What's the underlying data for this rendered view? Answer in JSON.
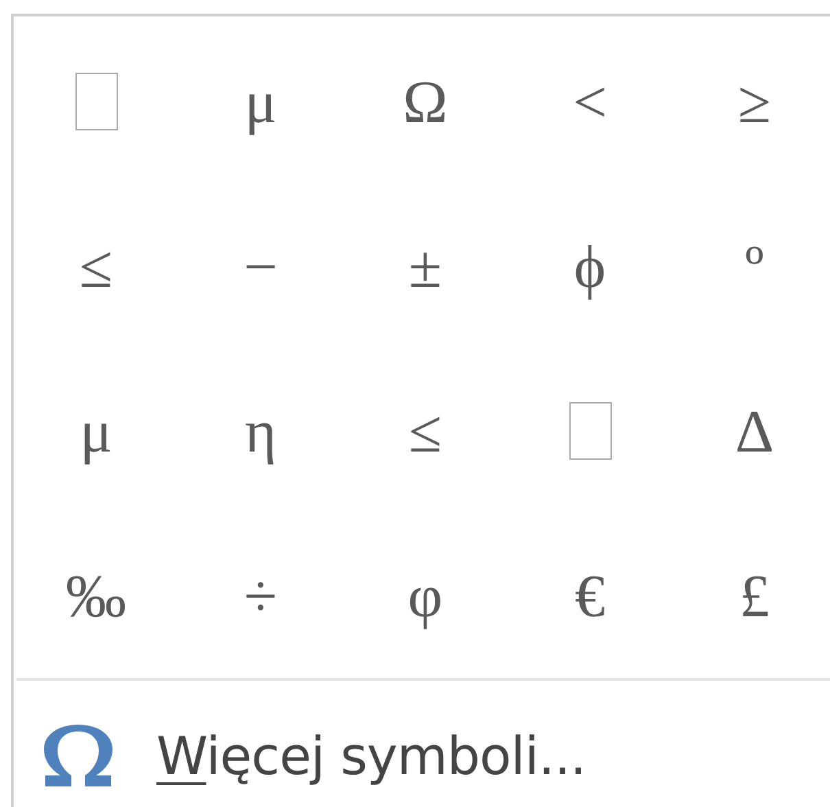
{
  "symbols": [
    {
      "kind": "missing"
    },
    {
      "kind": "glyph",
      "char": "μ"
    },
    {
      "kind": "glyph",
      "char": "Ω"
    },
    {
      "kind": "glyph",
      "char": "<"
    },
    {
      "kind": "glyph",
      "char": "≥"
    },
    {
      "kind": "glyph",
      "char": "≤"
    },
    {
      "kind": "glyph",
      "char": "−"
    },
    {
      "kind": "glyph",
      "char": "±"
    },
    {
      "kind": "glyph",
      "char": "ϕ"
    },
    {
      "kind": "glyph",
      "char": "º"
    },
    {
      "kind": "glyph",
      "char": "μ"
    },
    {
      "kind": "glyph",
      "char": "η"
    },
    {
      "kind": "glyph",
      "char": "≤"
    },
    {
      "kind": "missing"
    },
    {
      "kind": "glyph",
      "char": "Δ"
    },
    {
      "kind": "glyph",
      "char": "‰"
    },
    {
      "kind": "glyph",
      "char": "÷"
    },
    {
      "kind": "glyph",
      "char": "φ"
    },
    {
      "kind": "glyph",
      "char": "€"
    },
    {
      "kind": "glyph",
      "char": "£"
    }
  ],
  "more_symbols": {
    "access_key": "W",
    "label_rest": "ięcej symboli..."
  }
}
